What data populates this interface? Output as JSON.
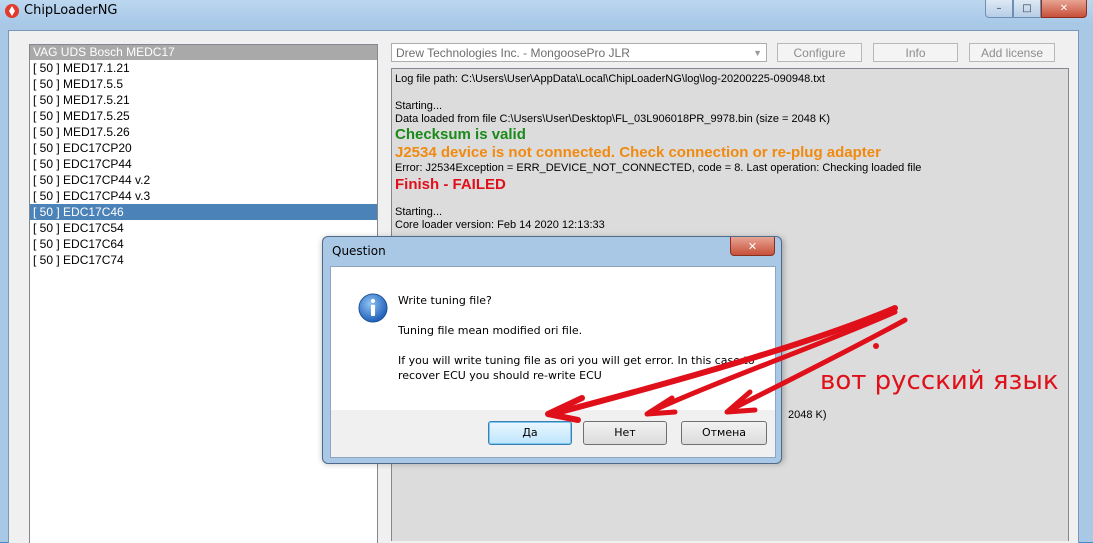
{
  "window": {
    "title": "ChipLoaderNG",
    "minimize": "–",
    "maximize": "□",
    "close": "✕"
  },
  "ecu_list": {
    "header": "VAG UDS Bosch MEDC17",
    "items": [
      {
        "label": "[ 50 ] MED17.1.21"
      },
      {
        "label": "[ 50 ] MED17.5.5"
      },
      {
        "label": "[ 50 ] MED17.5.21"
      },
      {
        "label": "[ 50 ] MED17.5.25"
      },
      {
        "label": "[ 50 ] MED17.5.26"
      },
      {
        "label": "[ 50 ] EDC17CP20"
      },
      {
        "label": "[ 50 ] EDC17CP44"
      },
      {
        "label": "[ 50 ] EDC17CP44 v.2"
      },
      {
        "label": "[ 50 ] EDC17CP44 v.3"
      },
      {
        "label": "[ 50 ] EDC17C46",
        "selected": true
      },
      {
        "label": "[ 50 ] EDC17C54"
      },
      {
        "label": "[ 50 ] EDC17C64"
      },
      {
        "label": "[ 50 ] EDC17C74"
      }
    ]
  },
  "toolbar": {
    "adapter_value": "Drew Technologies Inc. - MongoosePro JLR",
    "configure_label": "Configure",
    "info_label": "Info",
    "add_license_label": "Add license"
  },
  "log": {
    "path_line": "Log file path: C:\\Users\\User\\AppData\\Local\\ChipLoaderNG\\log\\log-20200225-090948.txt",
    "starting1": "Starting...",
    "data_loaded": "Data loaded from file C:\\Users\\User\\Desktop\\FL_03L906018PR_9978.bin (size = 2048 K)",
    "checksum": "Checksum is valid",
    "j2534": "J2534 device is not connected. Check connection or re-plug adapter",
    "error_line": "Error: J2534Exception = ERR_DEVICE_NOT_CONNECTED, code = 8. Last operation: Checking loaded file",
    "finish": "Finish - FAILED",
    "starting2": "Starting...",
    "core_loader": "Core loader version: Feb 14 2020 12:13:33",
    "partial_size": "2048 K)"
  },
  "dialog": {
    "title": "Question",
    "close": "✕",
    "line1": "Write tuning file?",
    "line2": "Tuning file mean modified ori file.",
    "line3": "If you will write tuning file as ori you will get error. In this case to",
    "line4": "recover ECU you should re-write ECU",
    "yes_label": "Да",
    "no_label": "Нет",
    "cancel_label": "Отмена",
    "icon": "info-icon"
  },
  "annotation": {
    "text": "вот русский язык",
    "color": "#e0101a"
  }
}
